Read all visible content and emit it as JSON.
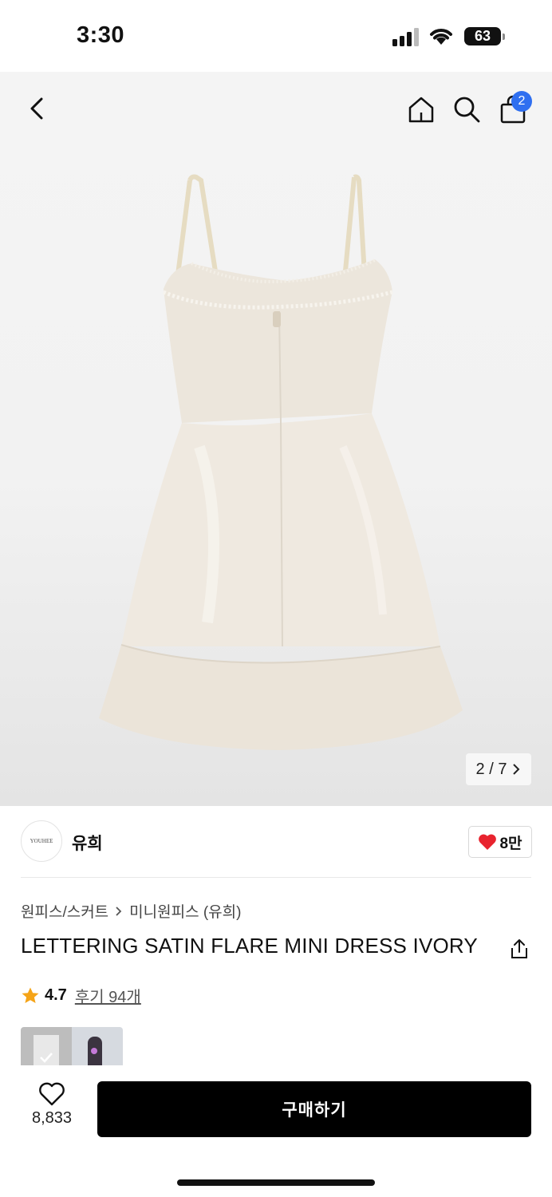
{
  "status_bar": {
    "time": "3:30",
    "battery": "63"
  },
  "nav": {
    "cart_count": "2"
  },
  "gallery": {
    "pager": "2 / 7",
    "image_desc": "ivory-satin-slip-dress-back-view"
  },
  "store": {
    "logo_text": "YOUHEE",
    "name": "유희",
    "like_count": "8만"
  },
  "breadcrumb": {
    "category": "원피스/스커트",
    "sub": "미니원피스 (유희)"
  },
  "product": {
    "title": "LETTERING SATIN FLARE MINI DRESS IVORY",
    "rating": "4.7",
    "reviews": "후기 94개"
  },
  "bottom": {
    "wish_count": "8,833",
    "buy_label": "구매하기"
  },
  "colors": {
    "accent": "#2f6ff0",
    "heart": "#e8232e",
    "star": "#f5a418"
  }
}
